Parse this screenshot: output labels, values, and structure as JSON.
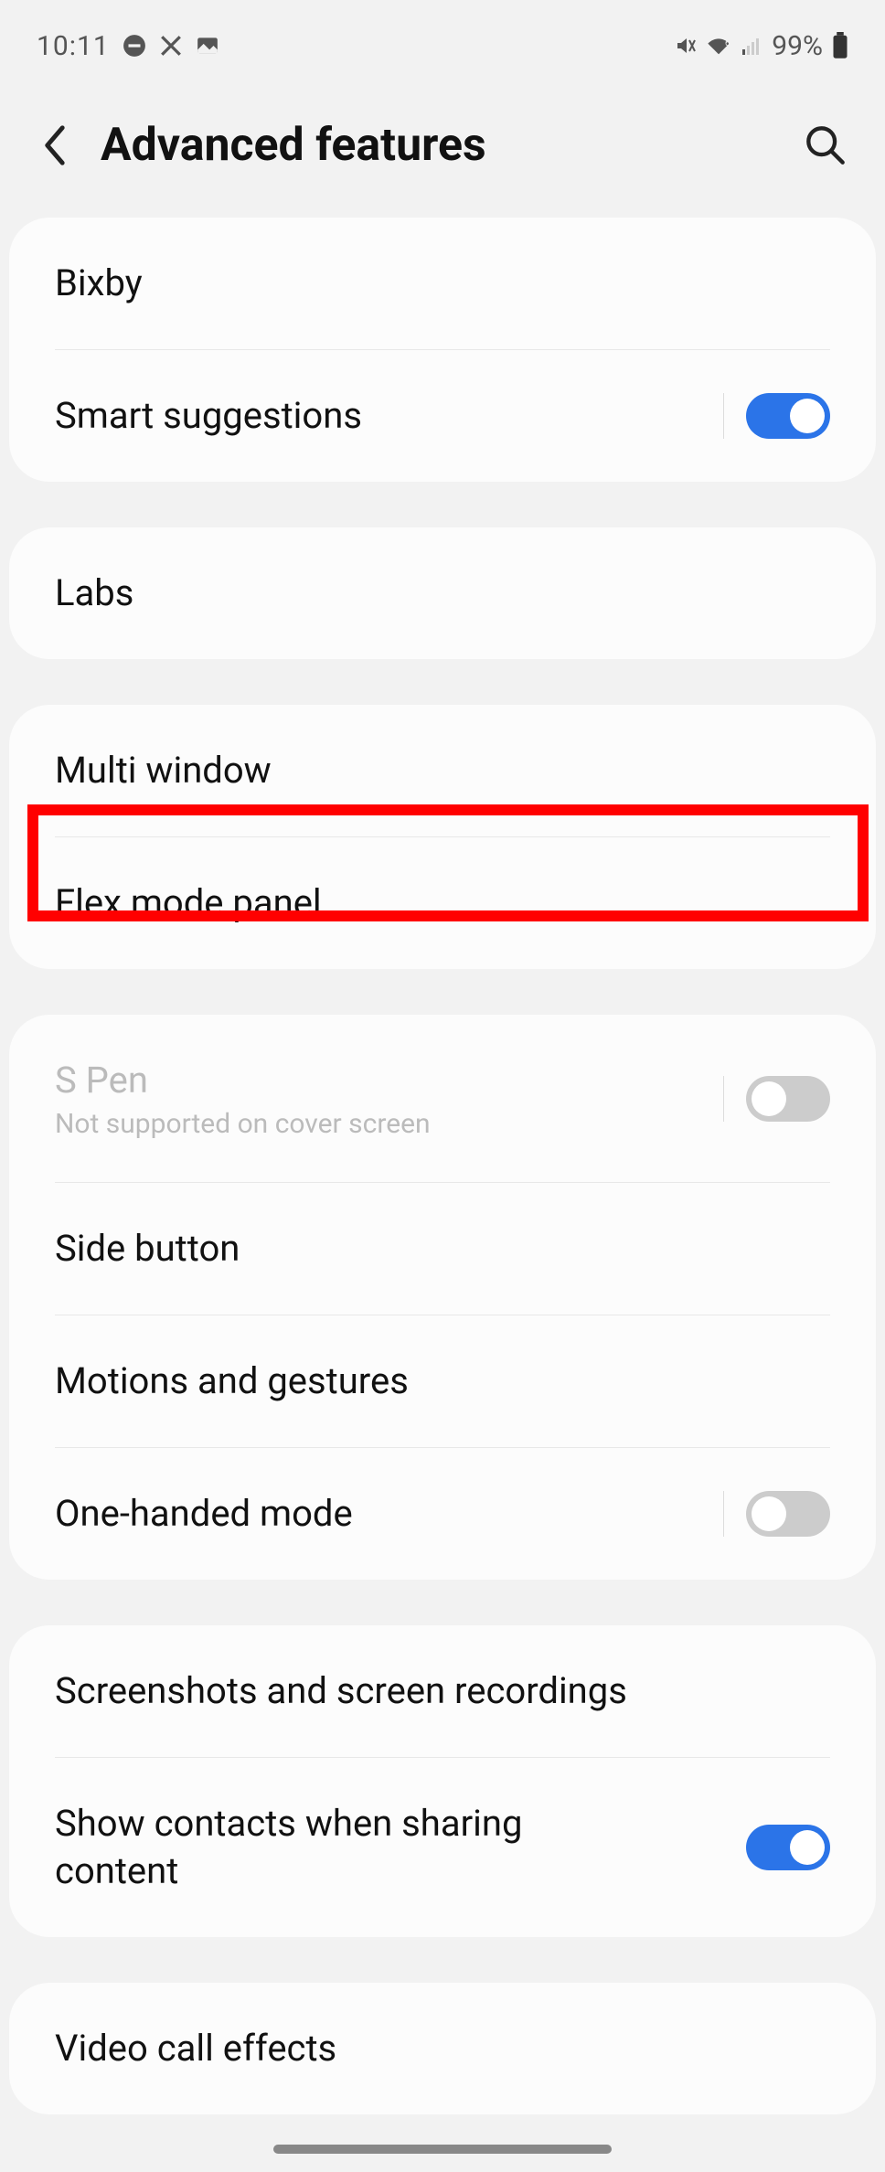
{
  "status": {
    "time": "10:11",
    "battery": "99%"
  },
  "header": {
    "title": "Advanced features"
  },
  "groups": [
    {
      "items": [
        {
          "label": "Bixby"
        },
        {
          "label": "Smart suggestions",
          "toggle": "on",
          "toggleDivider": true
        }
      ]
    },
    {
      "items": [
        {
          "label": "Labs"
        }
      ]
    },
    {
      "items": [
        {
          "label": "Multi window"
        },
        {
          "label": "Flex mode panel"
        }
      ]
    },
    {
      "items": [
        {
          "label": "S Pen",
          "sublabel": "Not supported on cover screen",
          "disabled": true,
          "toggle": "off",
          "toggleDivider": true
        },
        {
          "label": "Side button"
        },
        {
          "label": "Motions and gestures"
        },
        {
          "label": "One-handed mode",
          "toggle": "off",
          "toggleDivider": true
        }
      ]
    },
    {
      "items": [
        {
          "label": "Screenshots and screen recordings"
        },
        {
          "label": "Show contacts when sharing content",
          "toggle": "on"
        }
      ]
    },
    {
      "items": [
        {
          "label": "Video call effects"
        }
      ]
    }
  ]
}
